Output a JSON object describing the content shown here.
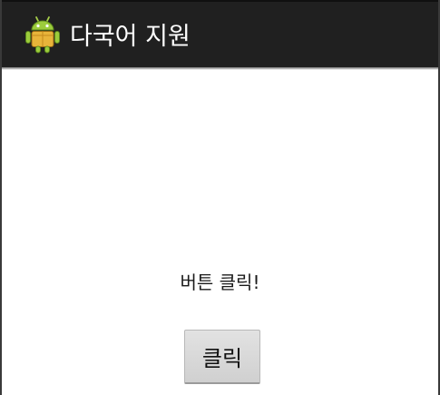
{
  "action_bar": {
    "title": "다국어 지원",
    "icon": "android-robot-icon",
    "background_color": "#202020",
    "title_color": "#ffffff",
    "icon_color": "#8ab43a"
  },
  "main": {
    "prompt": "버튼 클릭!",
    "button_label": "클릭"
  }
}
